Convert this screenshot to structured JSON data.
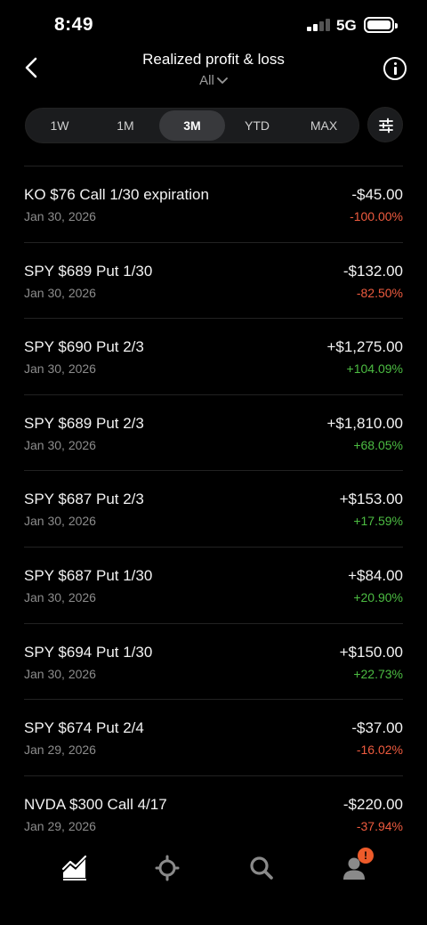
{
  "status_bar": {
    "time": "8:49",
    "network": "5G"
  },
  "header": {
    "title": "Realized profit & loss",
    "filter_label": "All"
  },
  "range_tabs": [
    {
      "label": "1W",
      "active": false
    },
    {
      "label": "1M",
      "active": false
    },
    {
      "label": "3M",
      "active": true
    },
    {
      "label": "YTD",
      "active": false
    },
    {
      "label": "MAX",
      "active": false
    }
  ],
  "positions": [
    {
      "name": "KO $76 Call 1/30 expiration",
      "date": "Jan 30, 2026",
      "amount": "-$45.00",
      "percent": "-100.00%",
      "direction": "neg"
    },
    {
      "name": "SPY $689 Put 1/30",
      "date": "Jan 30, 2026",
      "amount": "-$132.00",
      "percent": "-82.50%",
      "direction": "neg"
    },
    {
      "name": "SPY $690 Put 2/3",
      "date": "Jan 30, 2026",
      "amount": "+$1,275.00",
      "percent": "+104.09%",
      "direction": "pos"
    },
    {
      "name": "SPY $689 Put 2/3",
      "date": "Jan 30, 2026",
      "amount": "+$1,810.00",
      "percent": "+68.05%",
      "direction": "pos"
    },
    {
      "name": "SPY $687 Put 2/3",
      "date": "Jan 30, 2026",
      "amount": "+$153.00",
      "percent": "+17.59%",
      "direction": "pos"
    },
    {
      "name": "SPY $687 Put 1/30",
      "date": "Jan 30, 2026",
      "amount": "+$84.00",
      "percent": "+20.90%",
      "direction": "pos"
    },
    {
      "name": "SPY $694 Put 1/30",
      "date": "Jan 30, 2026",
      "amount": "+$150.00",
      "percent": "+22.73%",
      "direction": "pos"
    },
    {
      "name": "SPY $674 Put 2/4",
      "date": "Jan 29, 2026",
      "amount": "-$37.00",
      "percent": "-16.02%",
      "direction": "neg"
    },
    {
      "name": "NVDA $300 Call 4/17",
      "date": "Jan 29, 2026",
      "amount": "-$220.00",
      "percent": "-37.94%",
      "direction": "neg"
    }
  ],
  "tab_bar": {
    "items": [
      {
        "icon": "chart-icon"
      },
      {
        "icon": "crypto-icon"
      },
      {
        "icon": "search-icon"
      },
      {
        "icon": "account-icon"
      }
    ],
    "badge": "!"
  },
  "colors": {
    "negative": "#ee5b3f",
    "positive": "#4cbc42",
    "badge": "#ee5b2a"
  }
}
